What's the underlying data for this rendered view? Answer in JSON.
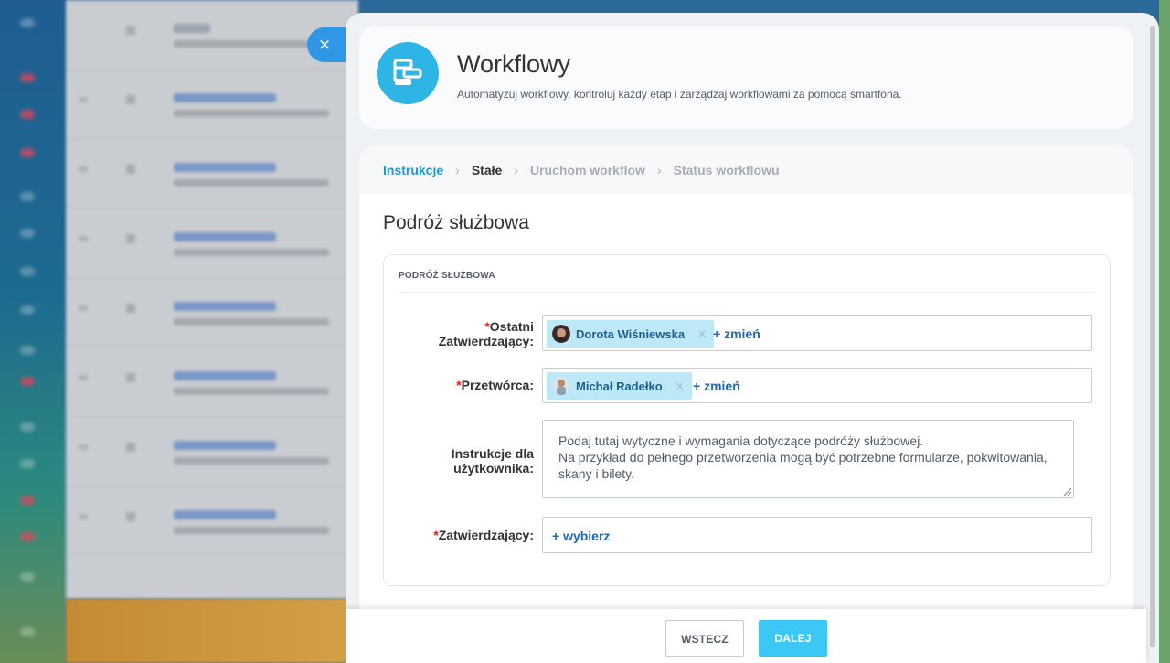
{
  "panel": {
    "close_icon": "×",
    "title": "Workflowy",
    "subtitle": "Automatyzuj workflowy, kontroluj każdy etap i zarządzaj workflowami za pomocą smartfona.",
    "logo_icon": "workflow-icon",
    "accent_color": "#2fb4e6"
  },
  "steps": [
    {
      "label": "Instrukcje",
      "state": "done"
    },
    {
      "label": "Stałe",
      "state": "current"
    },
    {
      "label": "Uruchom workflow",
      "state": "pending"
    },
    {
      "label": "Status workflowu",
      "state": "pending"
    }
  ],
  "step_separator": "›",
  "form": {
    "title": "Podróż służbowa",
    "section_label": "PODRÓŻ SŁUŻBOWA",
    "required_mark": "*",
    "fields": {
      "last_approver": {
        "label_line1": "Ostatni",
        "label_line2": "Zatwierdzający:",
        "user": "Dorota Wiśniewska",
        "remove": "×",
        "action": "+ zmień"
      },
      "processor": {
        "label": "Przetwórca:",
        "user": "Michał Radełko",
        "remove": "×",
        "action": "+ zmień"
      },
      "instructions": {
        "label_line1": "Instrukcje dla",
        "label_line2": "użytkownika:",
        "text_line1": "Podaj tutaj wytyczne i wymagania dotyczące podróży służbowej.",
        "text_line2": "Na przykład do pełnego przetworzenia mogą być potrzebne formularze, pokwitowania,",
        "text_line3": "skany i bilety."
      },
      "approvers": {
        "label": "Zatwierdzający:",
        "action": "+ wybierz"
      }
    }
  },
  "footer": {
    "back_label": "WSTECZ",
    "next_label": "DALEJ"
  }
}
